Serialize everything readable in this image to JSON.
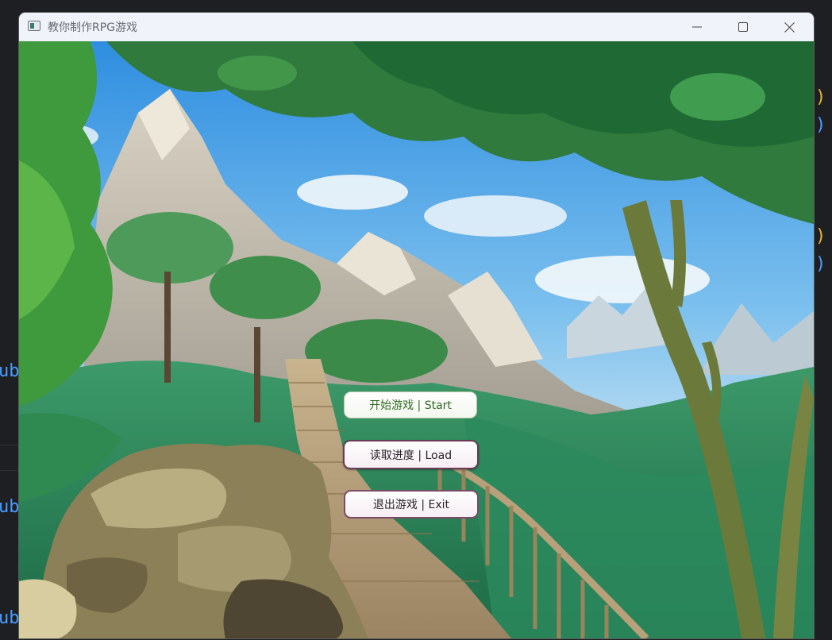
{
  "window": {
    "title": "教你制作RPG游戏",
    "controls": {
      "minimize": "minimize-icon",
      "maximize": "maximize-icon",
      "close": "close-icon"
    }
  },
  "menu": {
    "start_label": "开始游戏 | Start",
    "load_label": "读取进度 | Load",
    "exit_label": "退出游戏 | Exit"
  },
  "editor_fragments": {
    "ub_1": "ub",
    "ub_2": "ub",
    "ub_3": "ub",
    "brace_1": ")",
    "brace_2": ")",
    "brace_3": ")",
    "brace_4": ")"
  },
  "colors": {
    "start_text": "#2d6a1f",
    "button_border": "#6a3a56",
    "editor_blue": "#4a9cff",
    "editor_yellow": "#e8b62c"
  }
}
